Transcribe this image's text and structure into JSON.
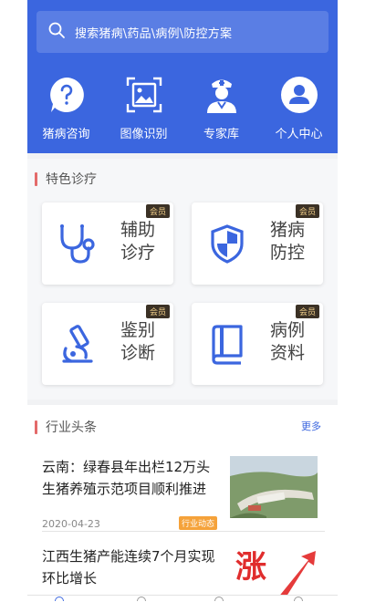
{
  "search": {
    "placeholder": "搜索猪病\\药品\\病例\\防控方案"
  },
  "quick_nav": [
    {
      "label": "猪病咨询",
      "icon": "question-icon"
    },
    {
      "label": "图像识别",
      "icon": "image-scan-icon"
    },
    {
      "label": "专家库",
      "icon": "doctor-icon"
    },
    {
      "label": "个人中心",
      "icon": "user-icon"
    }
  ],
  "features": {
    "title": "特色诊疗",
    "cards": [
      {
        "line1": "辅助",
        "line2": "诊疗",
        "badge": "会员",
        "icon": "stethoscope-icon"
      },
      {
        "line1": "猪病",
        "line2": "防控",
        "badge": "会员",
        "icon": "shield-icon"
      },
      {
        "line1": "鉴别",
        "line2": "诊断",
        "badge": "会员",
        "icon": "microscope-icon"
      },
      {
        "line1": "病例",
        "line2": "资料",
        "badge": "会员",
        "icon": "book-icon"
      }
    ]
  },
  "news": {
    "title": "行业头条",
    "more": "更多",
    "items": [
      {
        "title": "云南：绿春县年出栏12万头生猪养殖示范项目顺利推进",
        "date": "2020-04-23",
        "tag": "行业动态"
      },
      {
        "title": "江西生猪产能连续7个月实现环比增长",
        "thumb_text": "涨"
      }
    ]
  },
  "colors": {
    "brand": "#3b66df",
    "accent_bar": "#e36a6a",
    "badge_bg": "#3b3125",
    "badge_text": "#f3d08a",
    "tag": "#f5a23a"
  }
}
